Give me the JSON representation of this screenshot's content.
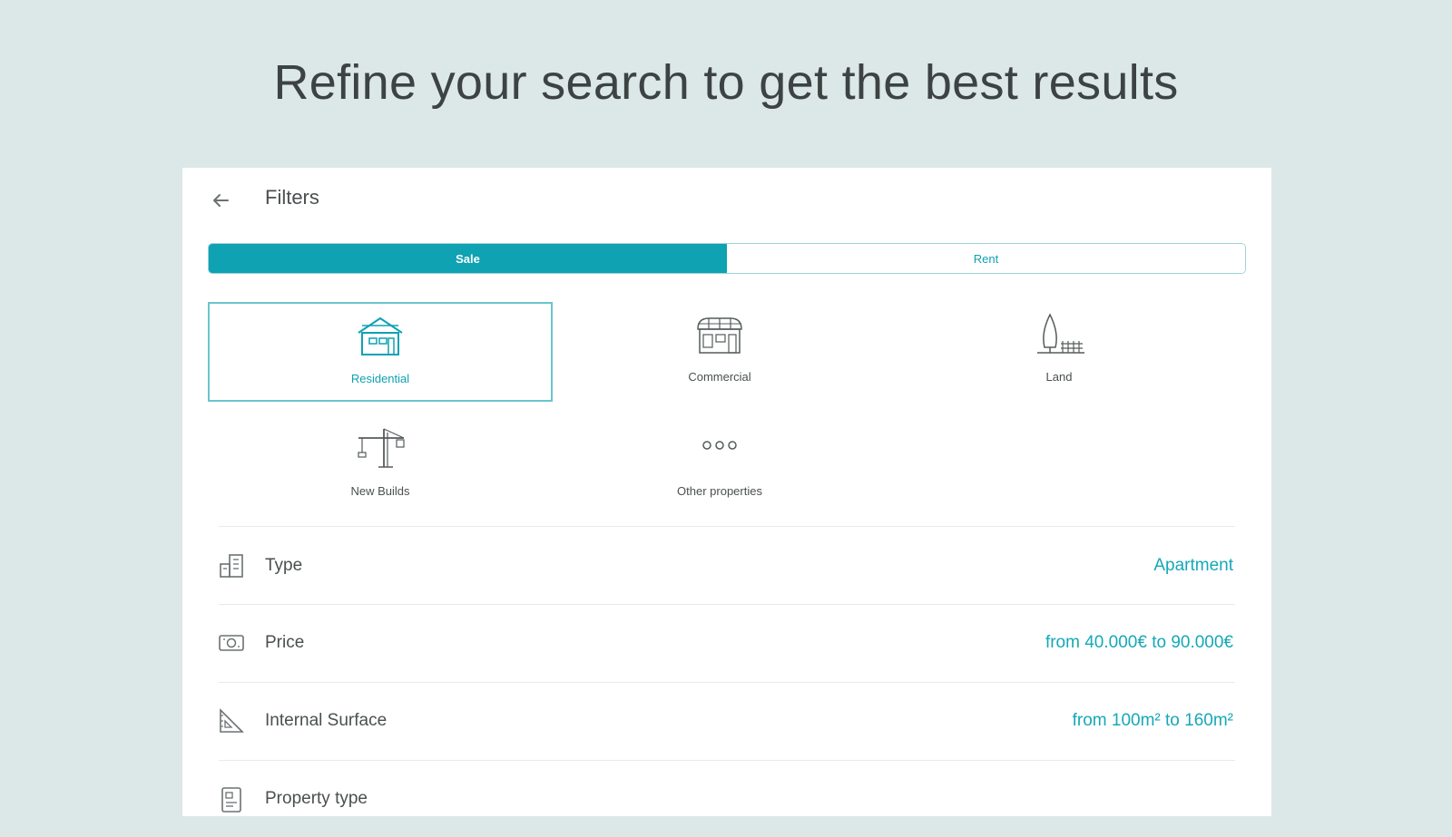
{
  "headline": "Refine your search to get the best results",
  "topbar": {
    "title": "Filters",
    "back_icon": "arrow-left-icon"
  },
  "segmented": {
    "options": [
      "Sale",
      "Rent"
    ],
    "selected": "Sale"
  },
  "categories": [
    {
      "label": "Residential",
      "icon": "house-icon",
      "selected": true
    },
    {
      "label": "Commercial",
      "icon": "storefront-icon",
      "selected": false
    },
    {
      "label": "Land",
      "icon": "tree-fence-icon",
      "selected": false
    },
    {
      "label": "New Builds",
      "icon": "crane-icon",
      "selected": false
    },
    {
      "label": "Other properties",
      "icon": "more-dots-icon",
      "selected": false
    }
  ],
  "filters": [
    {
      "label": "Type",
      "value": "Apartment",
      "icon": "building-icon"
    },
    {
      "label": "Price",
      "value": "from 40.000€ to 90.000€",
      "icon": "money-icon"
    },
    {
      "label": "Internal Surface",
      "value": "from 100m² to 160m²",
      "icon": "ruler-triangle-icon"
    },
    {
      "label": "Property type",
      "value": "",
      "icon": "document-icon"
    }
  ],
  "colors": {
    "accent": "#0ea2b2",
    "background": "#dce8e7",
    "panel": "#ffffff"
  }
}
